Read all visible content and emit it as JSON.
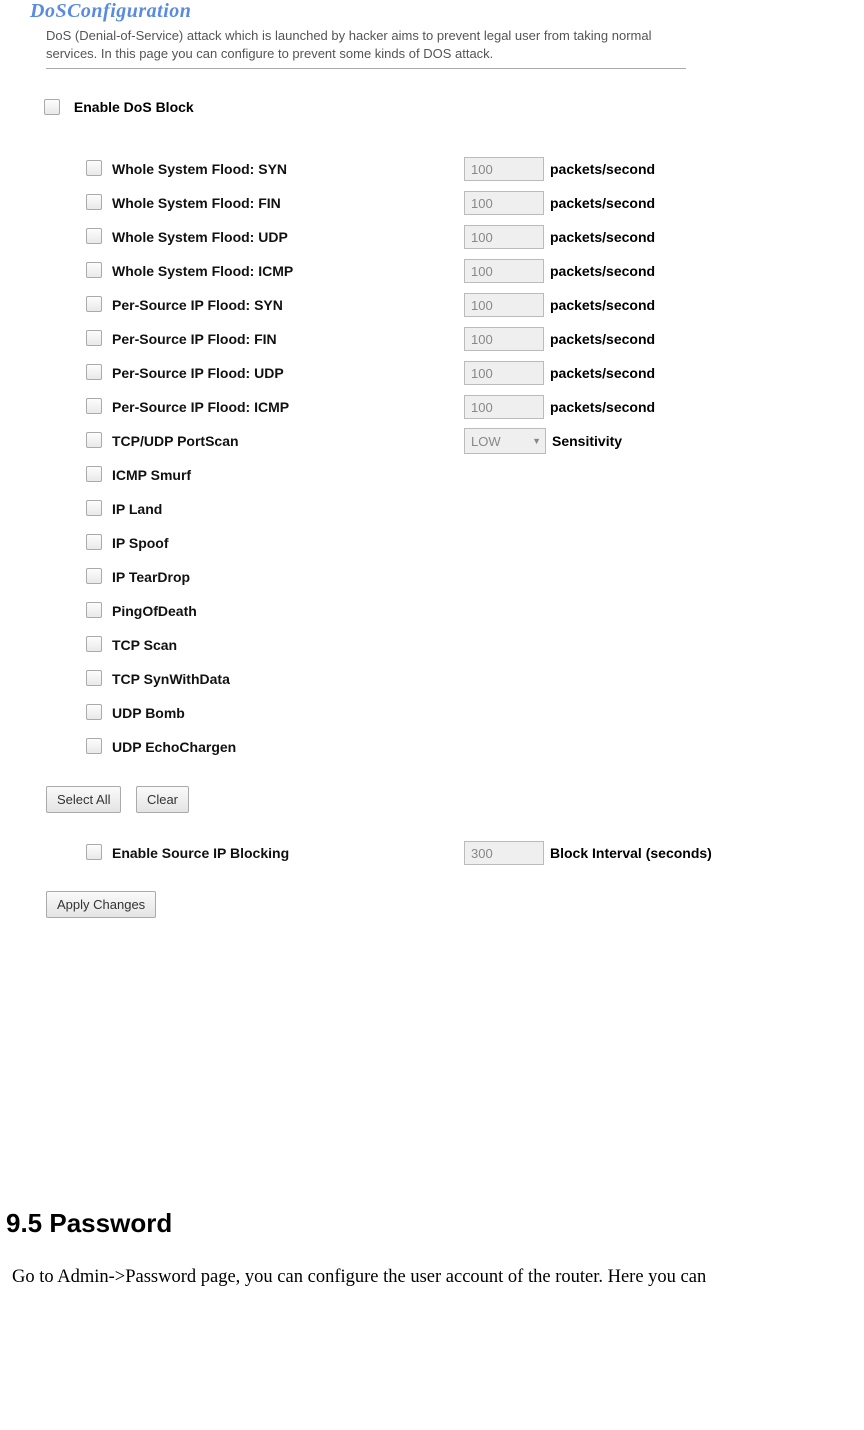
{
  "panel": {
    "title": "DoSConfiguration",
    "description": "DoS (Denial-of-Service) attack which is launched by hacker aims to prevent legal user from taking normal services. In this page you can configure to prevent some kinds of DOS attack.",
    "enable_label": "Enable DoS Block",
    "unit": "packets/second",
    "sensitivity_label": "Sensitivity",
    "sensitivity_value": "LOW",
    "options_with_value": [
      {
        "label": "Whole System Flood: SYN",
        "value": "100"
      },
      {
        "label": "Whole System Flood: FIN",
        "value": "100"
      },
      {
        "label": "Whole System Flood: UDP",
        "value": "100"
      },
      {
        "label": "Whole System Flood: ICMP",
        "value": "100"
      },
      {
        "label": "Per-Source IP Flood: SYN",
        "value": "100"
      },
      {
        "label": "Per-Source IP Flood: FIN",
        "value": "100"
      },
      {
        "label": "Per-Source IP Flood: UDP",
        "value": "100"
      },
      {
        "label": "Per-Source IP Flood: ICMP",
        "value": "100"
      }
    ],
    "portscan_label": "TCP/UDP PortScan",
    "options_plain": [
      "ICMP Smurf",
      "IP Land",
      "IP Spoof",
      "IP TearDrop",
      "PingOfDeath",
      "TCP Scan",
      "TCP SynWithData",
      "UDP Bomb",
      "UDP EchoChargen"
    ],
    "select_all_label": "Select All",
    "clear_label": "Clear",
    "source_block": {
      "label": "Enable Source IP Blocking",
      "value": "300",
      "unit": "Block Interval (seconds)"
    },
    "apply_label": "Apply Changes"
  },
  "doc": {
    "heading": "9.5 Password",
    "paragraph": "Go to Admin->Password page, you can configure the user account of the router. Here you can"
  }
}
